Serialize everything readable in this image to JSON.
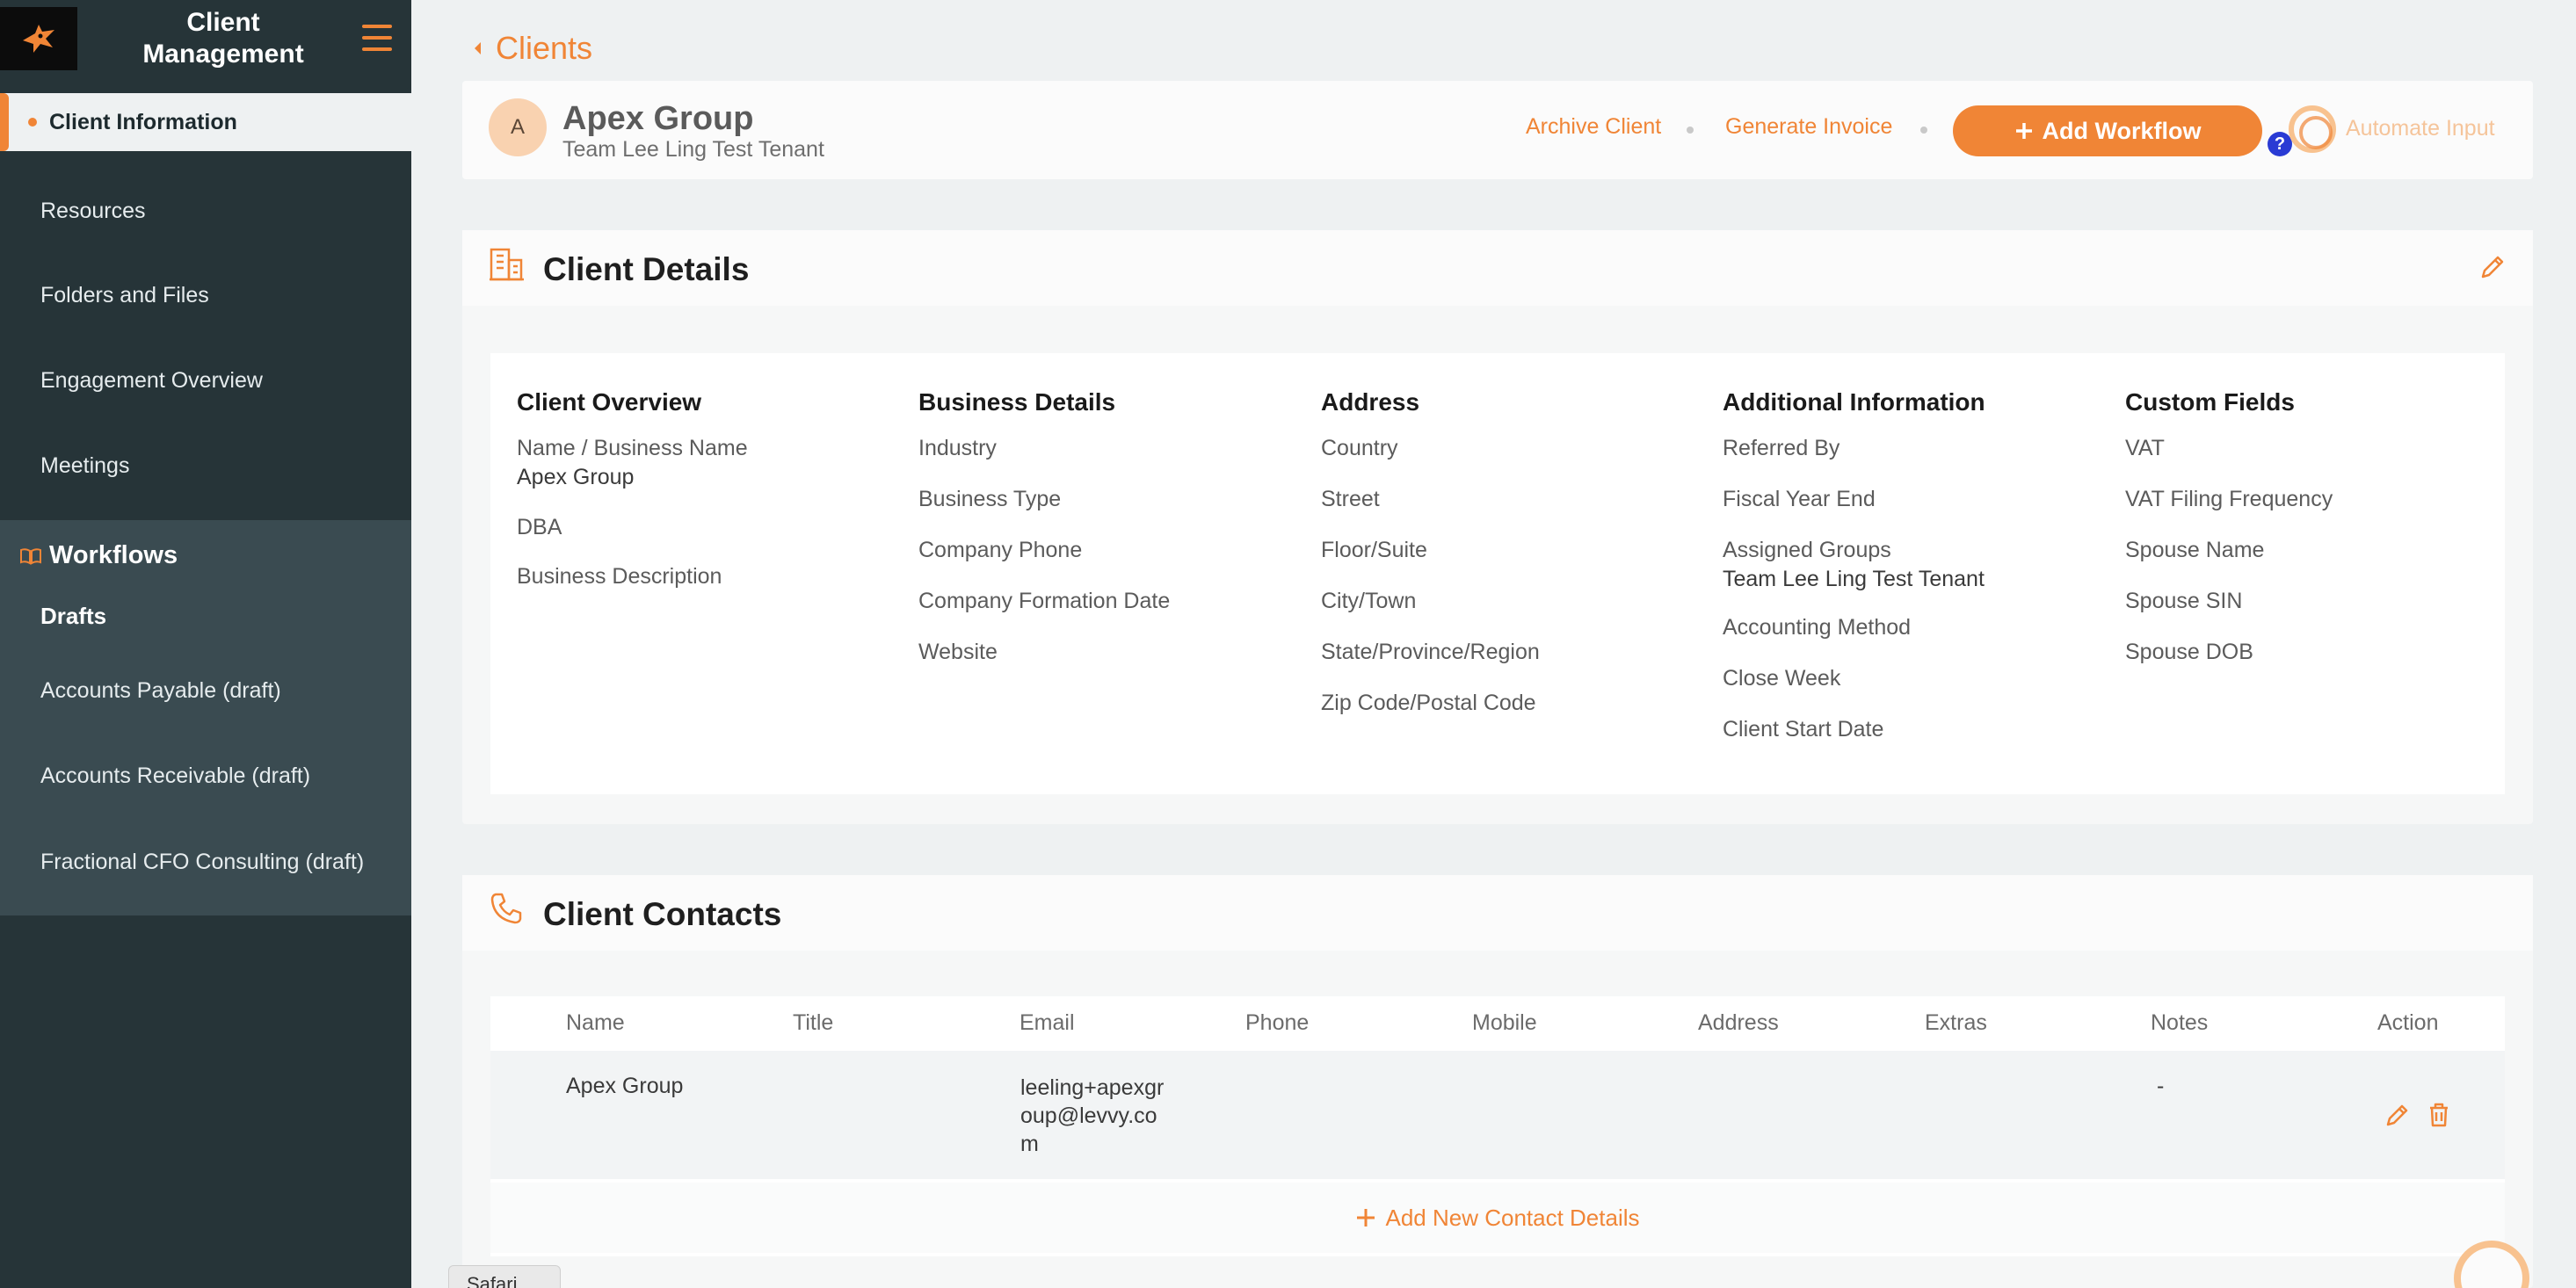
{
  "sidebar": {
    "title": "Client\nManagement",
    "active": "Client Information",
    "items": [
      "Resources",
      "Folders and Files",
      "Engagement Overview",
      "Meetings"
    ],
    "workflows": {
      "title": "Workflows",
      "drafts_label": "Drafts",
      "items": [
        "Accounts Payable (draft)",
        "Accounts Receivable (draft)",
        "Fractional CFO Consulting (draft)"
      ]
    }
  },
  "breadcrumb": {
    "back": "Clients"
  },
  "client": {
    "avatar": "A",
    "name": "Apex Group",
    "subtitle": "Team Lee Ling Test Tenant",
    "archive": "Archive Client",
    "invoice": "Generate Invoice",
    "add_workflow": "Add Workflow",
    "help": "?",
    "automate": "Automate Input"
  },
  "details": {
    "title": "Client Details",
    "columns": [
      {
        "heading": "Client Overview",
        "fields": [
          {
            "label": "Name / Business Name",
            "value": "Apex Group"
          },
          {
            "label": "DBA",
            "value": ""
          },
          {
            "label": "Business Description",
            "value": ""
          }
        ]
      },
      {
        "heading": "Business Details",
        "fields": [
          {
            "label": "Industry",
            "value": ""
          },
          {
            "label": "Business Type",
            "value": ""
          },
          {
            "label": "Company Phone",
            "value": ""
          },
          {
            "label": "Company Formation Date",
            "value": ""
          },
          {
            "label": "Website",
            "value": ""
          }
        ]
      },
      {
        "heading": "Address",
        "fields": [
          {
            "label": "Country",
            "value": ""
          },
          {
            "label": "Street",
            "value": ""
          },
          {
            "label": "Floor/Suite",
            "value": ""
          },
          {
            "label": "City/Town",
            "value": ""
          },
          {
            "label": "State/Province/Region",
            "value": ""
          },
          {
            "label": "Zip Code/Postal Code",
            "value": ""
          }
        ]
      },
      {
        "heading": "Additional Information",
        "fields": [
          {
            "label": "Referred By",
            "value": ""
          },
          {
            "label": "Fiscal Year End",
            "value": ""
          },
          {
            "label": "Assigned Groups",
            "value": "Team Lee Ling Test Tenant"
          },
          {
            "label": "Accounting Method",
            "value": ""
          },
          {
            "label": "Close Week",
            "value": ""
          },
          {
            "label": "Client Start Date",
            "value": ""
          }
        ]
      },
      {
        "heading": "Custom Fields",
        "fields": [
          {
            "label": "VAT",
            "value": ""
          },
          {
            "label": "VAT Filing Frequency",
            "value": ""
          },
          {
            "label": "Spouse Name",
            "value": ""
          },
          {
            "label": "Spouse SIN",
            "value": ""
          },
          {
            "label": "Spouse DOB",
            "value": ""
          }
        ]
      }
    ]
  },
  "contacts": {
    "title": "Client Contacts",
    "headers": [
      "Name",
      "Title",
      "Email",
      "Phone",
      "Mobile",
      "Address",
      "Extras",
      "Notes",
      "Action"
    ],
    "rows": [
      {
        "name": "Apex Group",
        "email_l1": "leeling+apexgr",
        "email_l2": "oup@levvy.co",
        "email_l3": "m",
        "notes": "-"
      }
    ],
    "add": "Add New Contact Details"
  },
  "browser": {
    "tab": "Safari"
  },
  "colors": {
    "accent": "#f08536",
    "sidebar": "#263438",
    "sidebar_workflows": "#3a4b51"
  }
}
